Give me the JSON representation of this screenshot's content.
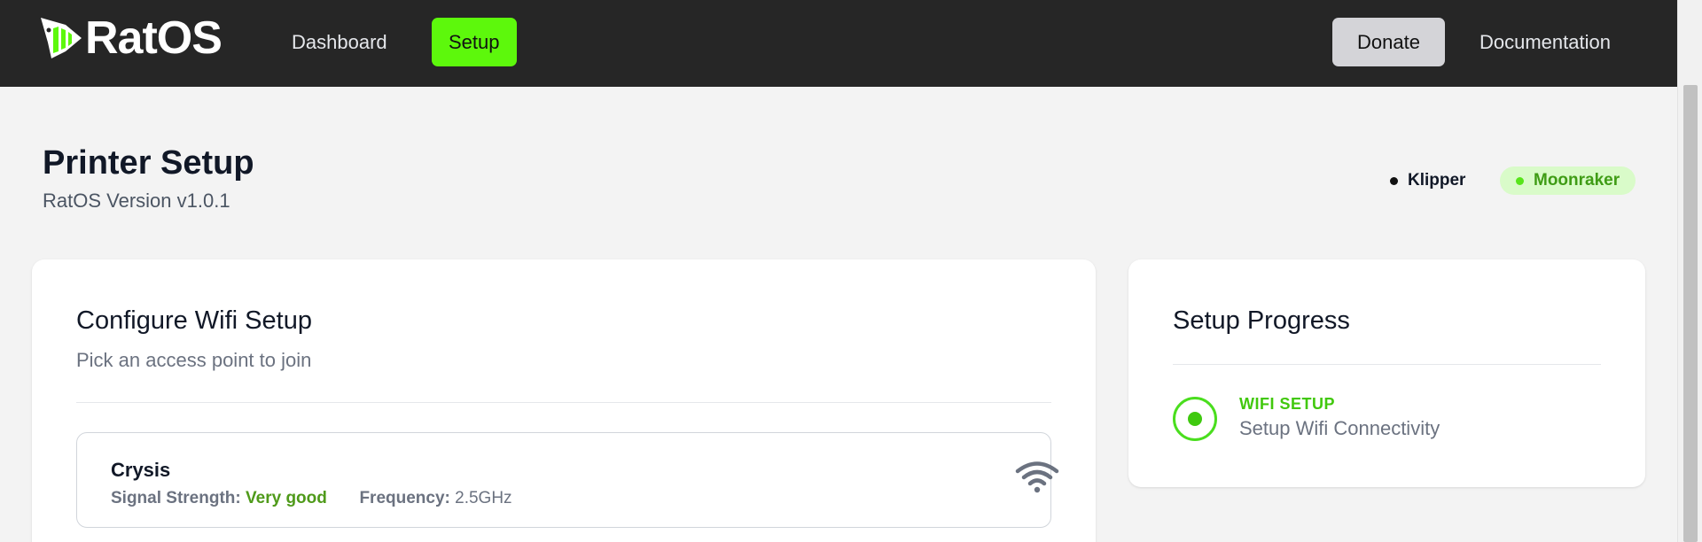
{
  "brand": {
    "name": "RatOS"
  },
  "nav": {
    "dashboard": "Dashboard",
    "setup": "Setup",
    "donate": "Donate",
    "documentation": "Documentation"
  },
  "page": {
    "title": "Printer Setup",
    "subtitle": "RatOS Version v1.0.1"
  },
  "status": {
    "klipper": "Klipper",
    "moonraker": "Moonraker"
  },
  "wifi_card": {
    "title": "Configure Wifi Setup",
    "subtitle": "Pick an access point to join",
    "access_points": [
      {
        "name": "Crysis",
        "signal_label": "Signal Strength:",
        "signal_value": "Very good",
        "frequency_label": "Frequency:",
        "frequency_value": "2.5GHz",
        "icon": "wifi-icon"
      }
    ]
  },
  "progress_card": {
    "title": "Setup Progress",
    "steps": [
      {
        "name": "WIFI SETUP",
        "description": "Setup Wifi Connectivity",
        "state": "current"
      }
    ]
  },
  "colors": {
    "nav_bg": "#262626",
    "accent": "#5df80c",
    "page_bg": "#f3f3f3",
    "success_text": "#41c80d",
    "moonraker_badge_bg": "#d9fbc9"
  }
}
